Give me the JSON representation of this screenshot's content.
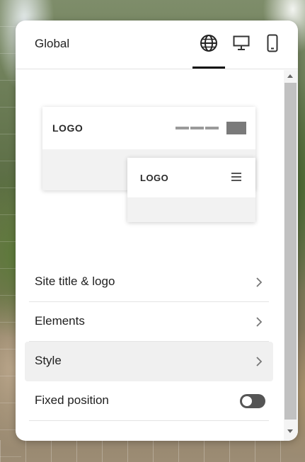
{
  "panel": {
    "title": "Global",
    "views": [
      {
        "name": "globe-icon",
        "active": true
      },
      {
        "name": "desktop-icon",
        "active": false
      },
      {
        "name": "mobile-icon",
        "active": false
      }
    ]
  },
  "preview": {
    "desktop_logo": "LOGO",
    "mobile_logo": "LOGO"
  },
  "menu": {
    "items": [
      {
        "label": "Site title & logo"
      },
      {
        "label": "Elements"
      },
      {
        "label": "Style"
      },
      {
        "label": "Fixed position"
      }
    ]
  },
  "colors": {
    "toggle_track": "#555555",
    "highlight_row": "#f0f0f0",
    "active_underline": "#111111"
  },
  "toggle": {
    "fixed_position_on": false
  }
}
